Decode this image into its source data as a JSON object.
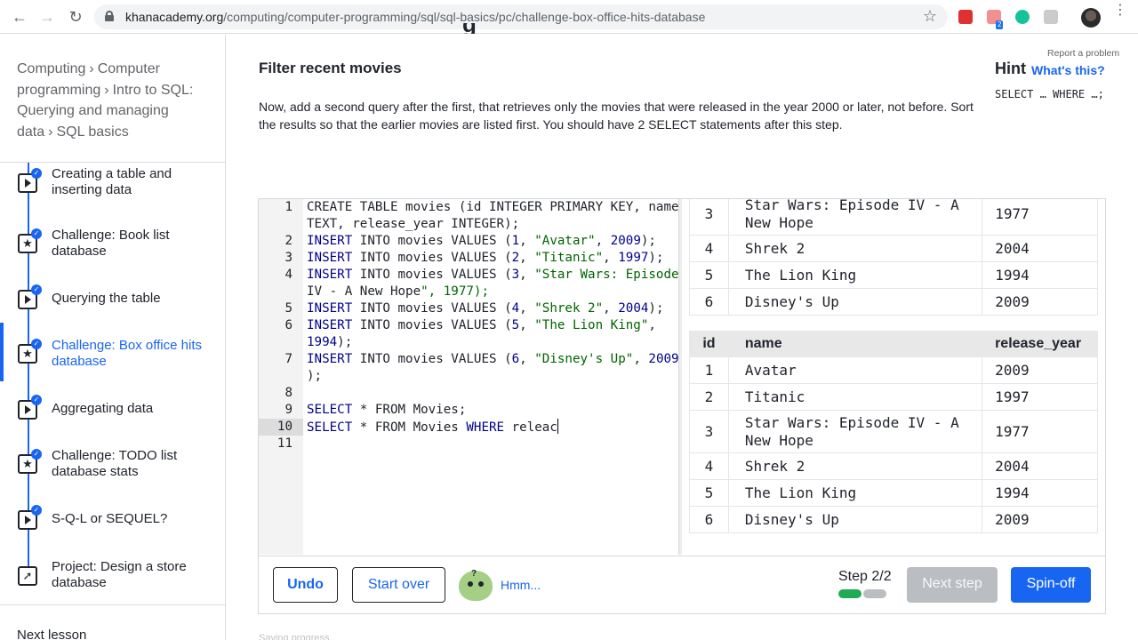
{
  "browser": {
    "url_domain": "khanacademy.org",
    "url_path": "/computing/computer-programming/sql/sql-basics/pc/challenge-box-office-hits-database",
    "extension_badge": "2"
  },
  "sidebar": {
    "breadcrumbs": [
      "Computing",
      "Computer programming",
      "Intro to SQL: Querying and managing data",
      "SQL basics"
    ],
    "lessons": [
      {
        "label": "Creating a table and inserting data",
        "kind": "talkthrough"
      },
      {
        "label": "Challenge: Book list database",
        "kind": "challenge"
      },
      {
        "label": "Querying the table",
        "kind": "talkthrough"
      },
      {
        "label": "Challenge: Box office hits database",
        "kind": "challenge",
        "active": true
      },
      {
        "label": "Aggregating data",
        "kind": "talkthrough"
      },
      {
        "label": "Challenge: TODO list database stats",
        "kind": "challenge"
      },
      {
        "label": "S-Q-L or SEQUEL?",
        "kind": "talkthrough"
      },
      {
        "label": "Project: Design a store database",
        "kind": "project"
      }
    ],
    "next_lesson": "Next lesson"
  },
  "main": {
    "title_fragment": "g",
    "heading": "Filter recent movies",
    "instructions": "Now, add a second query after the first, that retrieves only the movies that were released in the year 2000 or later, not before. Sort the results so that the earlier movies are listed first. You should have 2 SELECT statements after this step.",
    "report": "Report a problem",
    "hint_label": "Hint",
    "hint_link": "What's this?",
    "hint_code": "SELECT … WHERE …;"
  },
  "editor": {
    "line_numbers": [
      "1",
      "",
      "2",
      "3",
      "4",
      "",
      "5",
      "6",
      "",
      "7",
      "",
      "8",
      "9",
      "10",
      "11"
    ],
    "lines": [
      "CREATE TABLE movies (id INTEGER PRIMARY KEY, name",
      "TEXT, release_year INTEGER);",
      "INSERT INTO movies VALUES (1, \"Avatar\", 2009);",
      "INSERT INTO movies VALUES (2, \"Titanic\", 1997);",
      "INSERT INTO movies VALUES (3, \"Star Wars: Episode",
      "IV - A New Hope\", 1977);",
      "INSERT INTO movies VALUES (4, \"Shrek 2\", 2004);",
      "INSERT INTO movies VALUES (5, \"The Lion King\",",
      "1994);",
      "INSERT INTO movies VALUES (6, \"Disney's Up\", 2009",
      ");",
      "",
      "SELECT * FROM Movies;",
      "SELECT * FROM Movies WHERE releac",
      ""
    ],
    "active_line": "10"
  },
  "results": {
    "table1_rows": [
      [
        "3",
        "Star Wars: Episode IV - A New Hope",
        "1977"
      ],
      [
        "4",
        "Shrek 2",
        "2004"
      ],
      [
        "5",
        "The Lion King",
        "1994"
      ],
      [
        "6",
        "Disney's Up",
        "2009"
      ]
    ],
    "columns": [
      "id",
      "name",
      "release_year"
    ],
    "table2_rows": [
      [
        "1",
        "Avatar",
        "2009"
      ],
      [
        "2",
        "Titanic",
        "1997"
      ],
      [
        "3",
        "Star Wars: Episode IV - A New Hope",
        "1977"
      ],
      [
        "4",
        "Shrek 2",
        "2004"
      ],
      [
        "5",
        "The Lion King",
        "1994"
      ],
      [
        "6",
        "Disney's Up",
        "2009"
      ]
    ]
  },
  "footer": {
    "undo": "Undo",
    "start_over": "Start over",
    "hmm": "Hmm...",
    "step": "Step 2/2",
    "next_step": "Next step",
    "spinoff": "Spin-off",
    "progress_fraction": 0.5,
    "below_text": "Saving progress..."
  },
  "colors": {
    "accent": "#1865f2",
    "progress_done": "#1fab54",
    "progress_todo": "#babec2"
  }
}
